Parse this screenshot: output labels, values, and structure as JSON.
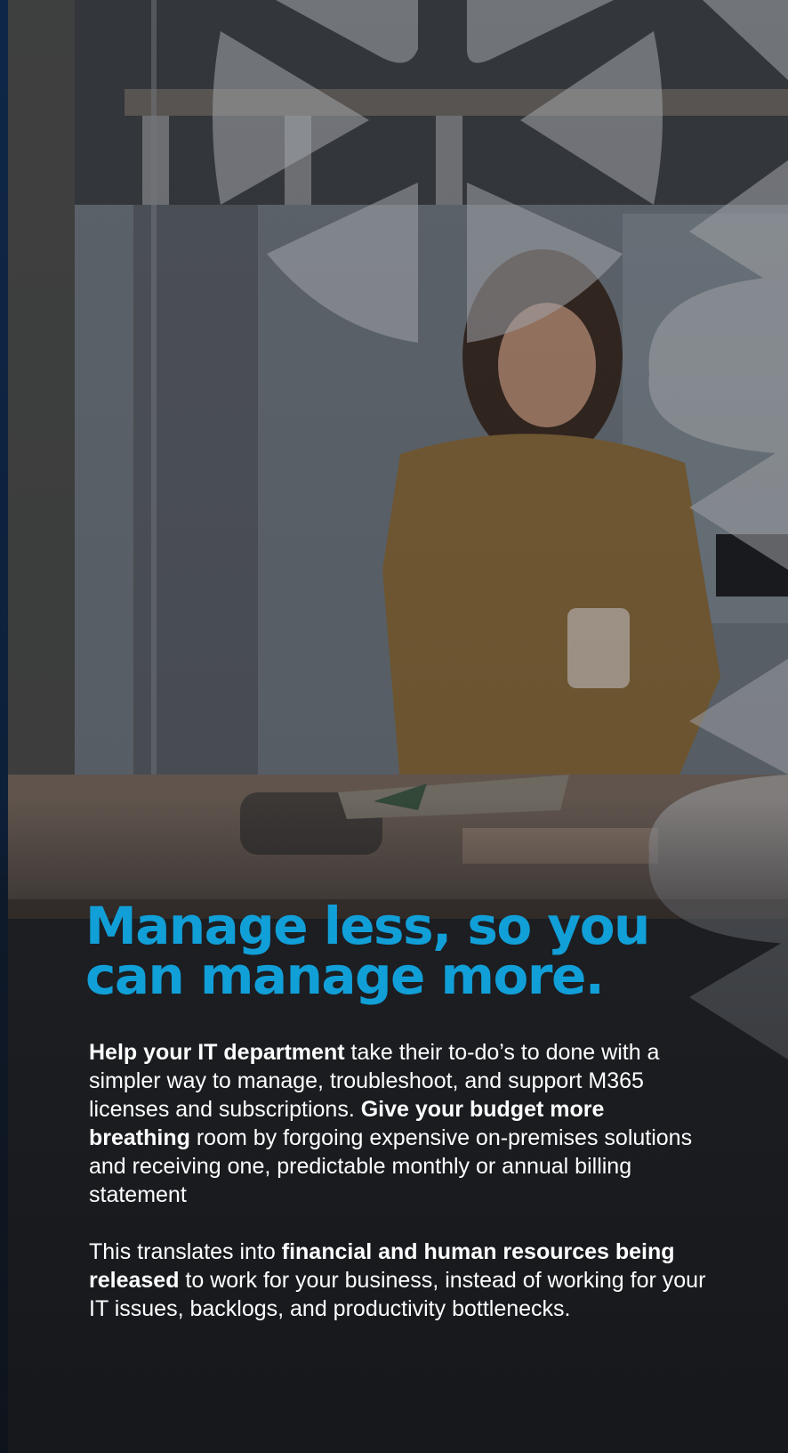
{
  "headline": {
    "line1": "Manage less, so you",
    "line2": "can manage more."
  },
  "paragraph1": {
    "bold1": "Help your IT department",
    "text1": " take their to-do’s to done with a simpler way to manage, troubleshoot, and support M365 licenses and subscriptions. ",
    "bold2": "Give your budget more breathing",
    "text2": " room by forgoing expensive on-premises solutions and receiving one, predictable monthly or annual billing statement"
  },
  "paragraph2": {
    "text1": "This translates into ",
    "bold1": "financial and human resources being released",
    "text2": " to work for your business, instead of working for your IT issues, backlogs, and productivity bottlenecks."
  },
  "colors": {
    "headline": "#119fd8",
    "body_text": "#ffffff",
    "left_edge": "#0e2c55"
  },
  "icons": [
    "snowflake-pattern-decoration"
  ]
}
